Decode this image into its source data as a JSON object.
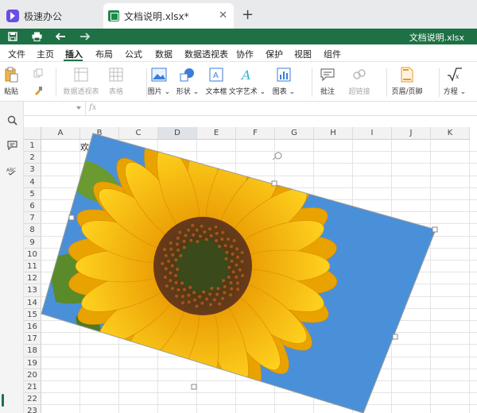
{
  "tabs": {
    "home_label": "极速办公",
    "doc_label": "文档说明.xlsx*",
    "close_glyph": "✕",
    "new_tab_glyph": "+"
  },
  "quickbar": {
    "title": "文档说明.xlsx"
  },
  "menu": [
    {
      "label": "文件",
      "active": false
    },
    {
      "label": "主页",
      "active": false
    },
    {
      "label": "插入",
      "active": true
    },
    {
      "label": "布局",
      "active": false
    },
    {
      "label": "公式",
      "active": false
    },
    {
      "label": "数据",
      "active": false
    },
    {
      "label": "数据透视表",
      "active": false
    },
    {
      "label": "协作",
      "active": false
    },
    {
      "label": "保护",
      "active": false
    },
    {
      "label": "视图",
      "active": false
    },
    {
      "label": "组件",
      "active": false
    }
  ],
  "ribbon": [
    {
      "label": "粘贴",
      "icon": "paste-icon",
      "disabled": false
    },
    {
      "label": "数据透视表",
      "icon": "pivot-table-icon",
      "disabled": true
    },
    {
      "label": "表格",
      "icon": "table-icon",
      "disabled": true
    },
    {
      "label": "图片 ⌄",
      "icon": "picture-icon",
      "disabled": false
    },
    {
      "label": "形状 ⌄",
      "icon": "shape-icon",
      "disabled": false
    },
    {
      "label": "文本框",
      "icon": "textbox-icon",
      "disabled": false
    },
    {
      "label": "文字艺术 ⌄",
      "icon": "wordart-icon",
      "disabled": false
    },
    {
      "label": "图表 ⌄",
      "icon": "chart-icon",
      "disabled": false
    },
    {
      "label": "批注",
      "icon": "comment-icon",
      "disabled": false
    },
    {
      "label": "超链接",
      "icon": "hyperlink-icon",
      "disabled": true
    },
    {
      "label": "页眉/页脚",
      "icon": "header-footer-icon",
      "disabled": false
    },
    {
      "label": "方程 ⌄",
      "icon": "equation-icon",
      "disabled": false
    }
  ],
  "formula_bar": {
    "fx_label": "fx"
  },
  "sheet": {
    "columns": [
      "A",
      "B",
      "C",
      "D",
      "E",
      "F",
      "G",
      "H",
      "I",
      "J",
      "K"
    ],
    "selected_column": "D",
    "rows": [
      "1",
      "2",
      "3",
      "4",
      "5",
      "6",
      "7",
      "8",
      "9",
      "10",
      "11",
      "12",
      "13",
      "14",
      "15",
      "16",
      "17",
      "18",
      "19",
      "20",
      "21",
      "22",
      "23"
    ],
    "cell_b1": "欢迎"
  },
  "image": {
    "subject": "sunflower",
    "rotation_deg": 24,
    "colors": {
      "sky": "#4a90d9",
      "petal": "#f7b500",
      "petal_dark": "#e08a00",
      "center": "#6b3a1a",
      "center_inner": "#3b4a1a",
      "leaf": "#5b8a2a"
    }
  },
  "colors": {
    "brand_green": "#1e7145",
    "tab_bg": "#e9eaec",
    "app_purple": "#6b4ce6"
  }
}
